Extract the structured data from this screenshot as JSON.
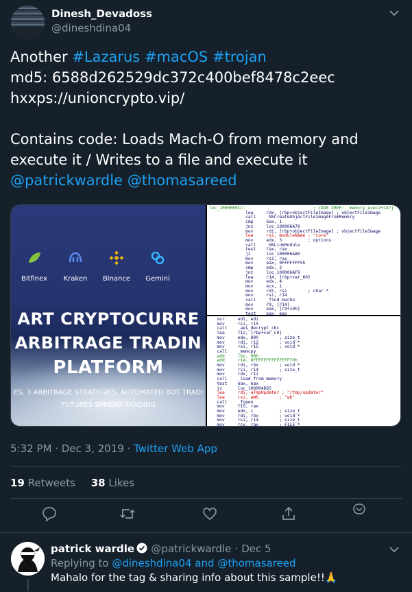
{
  "tweet": {
    "author_name": "Dinesh_Devadoss",
    "author_handle": "@dineshdina04",
    "lines": [
      {
        "parts": [
          {
            "t": "Another "
          },
          {
            "t": "#Lazarus",
            "link": true
          },
          {
            "t": " "
          },
          {
            "t": "#macOS",
            "link": true
          },
          {
            "t": " "
          },
          {
            "t": "#trojan",
            "link": true
          }
        ]
      },
      {
        "parts": [
          {
            "t": "md5: 6588d262529dc372c400bef8478c2eec"
          }
        ]
      },
      {
        "parts": [
          {
            "t": "hxxps://unioncrypto.vip/"
          }
        ]
      },
      {
        "parts": [
          {
            "t": ""
          }
        ]
      },
      {
        "parts": [
          {
            "t": "Contains code: Loads Mach-O from memory and"
          }
        ]
      },
      {
        "parts": [
          {
            "t": "execute it /  Writes to a file and execute it"
          }
        ]
      },
      {
        "parts": [
          {
            "t": "@patrickwardle",
            "link": true
          },
          {
            "t": " "
          },
          {
            "t": "@thomasareed",
            "link": true
          }
        ]
      }
    ],
    "timestamp": "5:32 PM · Dec 3, 2019 · ",
    "source_app": "Twitter Web App",
    "retweets_count": "19",
    "retweets_label": "Retweets",
    "likes_count": "38",
    "likes_label": "Likes"
  },
  "media": {
    "exchanges": [
      "Bitfinex",
      "Kraken",
      "Binance",
      "Gemini"
    ],
    "headline_1": "ART CRYPTOCURRE",
    "headline_2": "ARBITRAGE TRADIN",
    "headline_3": "PLATFORM",
    "subline_1": "ES, 3 ARBITRAGE STRATEGIES, AUTOMATED BOT TRADI",
    "subline_2": "FUTURES SPREAD TRADING",
    "disasm_top": [
      {
        "c": "loc_1000069CC:                          ; CODE XREF: _memory_exec2+247j",
        "k": "g"
      },
      {
        "c": "              lea     rdx, [rbp+objectFileImage] ; objectFileImage"
      },
      {
        "c": "              call    _NSCreateObjectFileImageFromMemory"
      },
      {
        "c": "              cmp     eax, 1"
      },
      {
        "c": "              jnz     loc_100006A79"
      },
      {
        "c": "              mov     rdi, [rbp+objectFileImage] ; objectFileImage"
      },
      {
        "c": "              lea     rsi, moduleName ; \"core\"",
        "k": "r"
      },
      {
        "c": "              mov     edx, 3          ; options"
      },
      {
        "c": "              call    _NSLinkModule"
      },
      {
        "c": "              test    rax, rax"
      },
      {
        "c": "              jz      loc_100006AA0"
      },
      {
        "c": "              mov     rsi, rax"
      },
      {
        "c": "              mov     eax, 0FFFFFFF5h"
      },
      {
        "c": "              cmp     edx, 2"
      },
      {
        "c": "              jnz     loc_100006AF9"
      },
      {
        "c": "              lea     r14, [rbp+var_60]"
      },
      {
        "c": "              mov     edx, 4"
      },
      {
        "c": "              mov     ecx, 1"
      },
      {
        "c": "              mov     rdi, rsi        ; char *"
      },
      {
        "c": "              mov     rsi, r14"
      },
      {
        "c": "              call    _find_macho"
      },
      {
        "c": "              mov     r9, [r14]"
      },
      {
        "c": "              mov     eax, [r9+10h]"
      },
      {
        "c": "              test    eax, eax"
      },
      {
        "c": "              jz      short loc_100006A4F"
      }
    ],
    "disasm_bottom": [
      {
        "c": "   xor     edi, edi"
      },
      {
        "c": "   mov     rsi, r15"
      },
      {
        "c": "   call    _aes_decrypt_cbc"
      },
      {
        "c": "   lea     r12, [rbp+var_C0]"
      },
      {
        "c": "   mov     edx, 80h        ; size_t"
      },
      {
        "c": "   mov     rdi, r12        ; void *"
      },
      {
        "c": "   mov     rsi, r15        ; void *"
      },
      {
        "c": "   call    _memcpy"
      },
      {
        "c": "   add     rbx, 90h",
        "k": "g"
      },
      {
        "c": "   add     r14, 0FFFFFFFFFFFFFF70h",
        "k": "g"
      },
      {
        "c": "   mov     rdi, rbx        ; void *"
      },
      {
        "c": "   mov     rsi, r14        ; size_t"
      },
      {
        "c": "   mov     rdx, r12"
      },
      {
        "c": "   call    _load_from_memory"
      },
      {
        "c": "   test    eax, eax"
      },
      {
        "c": "   jz      loc_100004D65"
      },
      {
        "c": "   lea     rdi, aTmpUpdater ; \"/tmp/updater\"",
        "k": "r"
      },
      {
        "c": "   lea     rsi, aWb        ; \"wb\"",
        "k": "r"
      },
      {
        "c": "   call    _fopen"
      },
      {
        "c": "   mov     r15, rax"
      },
      {
        "c": "   mov     edx, 1          ; size_t"
      },
      {
        "c": "   mov     rdi, rbx        ; void *"
      },
      {
        "c": "   mov     rsi, r14        ; size_t"
      },
      {
        "c": "   mov     rcx, rax        ; FILE *"
      },
      {
        "c": "   call    _fwrite"
      },
      {
        "c": "   mov     rdi, r15        ; FILE *"
      }
    ]
  },
  "reply": {
    "author_name": "patrick wardle",
    "author_handle": "@patrickwardle",
    "date": "· Dec 5",
    "replying_prefix": "Replying to ",
    "replying_to": "@dineshdina04 and @thomasareed",
    "text": "Mahalo for the tag & sharing info about this sample!!🙏"
  },
  "colors": {
    "background": "#15202b",
    "accent": "#1da1f2",
    "secondary_text": "#8899a6",
    "divider": "#38444d"
  },
  "icons": [
    "chevron-down-icon",
    "reply-icon",
    "retweet-icon",
    "like-icon",
    "share-icon",
    "bookmark-icon",
    "verified-icon"
  ]
}
